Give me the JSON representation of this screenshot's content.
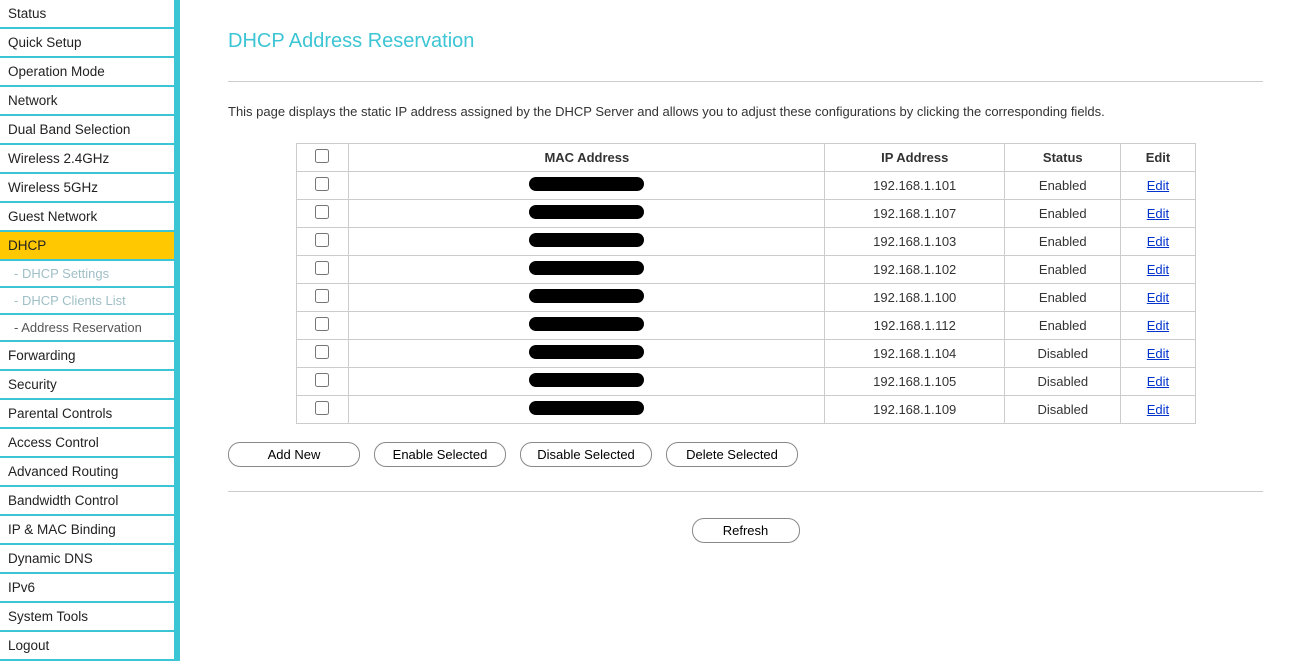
{
  "sidebar": {
    "items": [
      {
        "label": "Status"
      },
      {
        "label": "Quick Setup"
      },
      {
        "label": "Operation Mode"
      },
      {
        "label": "Network"
      },
      {
        "label": "Dual Band Selection"
      },
      {
        "label": "Wireless 2.4GHz"
      },
      {
        "label": "Wireless 5GHz"
      },
      {
        "label": "Guest Network"
      },
      {
        "label": "DHCP",
        "active": true,
        "subs": [
          {
            "label": "- DHCP Settings"
          },
          {
            "label": "- DHCP Clients List"
          },
          {
            "label": "- Address Reservation",
            "current": true
          }
        ]
      },
      {
        "label": "Forwarding"
      },
      {
        "label": "Security"
      },
      {
        "label": "Parental Controls"
      },
      {
        "label": "Access Control"
      },
      {
        "label": "Advanced Routing"
      },
      {
        "label": "Bandwidth Control"
      },
      {
        "label": "IP & MAC Binding"
      },
      {
        "label": "Dynamic DNS"
      },
      {
        "label": "IPv6"
      },
      {
        "label": "System Tools"
      },
      {
        "label": "Logout"
      }
    ]
  },
  "page": {
    "title": "DHCP Address Reservation",
    "description": "This page displays the static IP address assigned by the DHCP Server and allows you to adjust these configurations by clicking the corresponding fields."
  },
  "table": {
    "headers": {
      "mac": "MAC Address",
      "ip": "IP Address",
      "status": "Status",
      "edit": "Edit"
    },
    "edit_label": "Edit",
    "rows": [
      {
        "ip": "192.168.1.101",
        "status": "Enabled"
      },
      {
        "ip": "192.168.1.107",
        "status": "Enabled"
      },
      {
        "ip": "192.168.1.103",
        "status": "Enabled"
      },
      {
        "ip": "192.168.1.102",
        "status": "Enabled"
      },
      {
        "ip": "192.168.1.100",
        "status": "Enabled"
      },
      {
        "ip": "192.168.1.112",
        "status": "Enabled"
      },
      {
        "ip": "192.168.1.104",
        "status": "Disabled"
      },
      {
        "ip": "192.168.1.105",
        "status": "Disabled"
      },
      {
        "ip": "192.168.1.109",
        "status": "Disabled"
      }
    ]
  },
  "buttons": {
    "add_new": "Add New",
    "enable_selected": "Enable Selected",
    "disable_selected": "Disable Selected",
    "delete_selected": "Delete Selected",
    "refresh": "Refresh"
  }
}
